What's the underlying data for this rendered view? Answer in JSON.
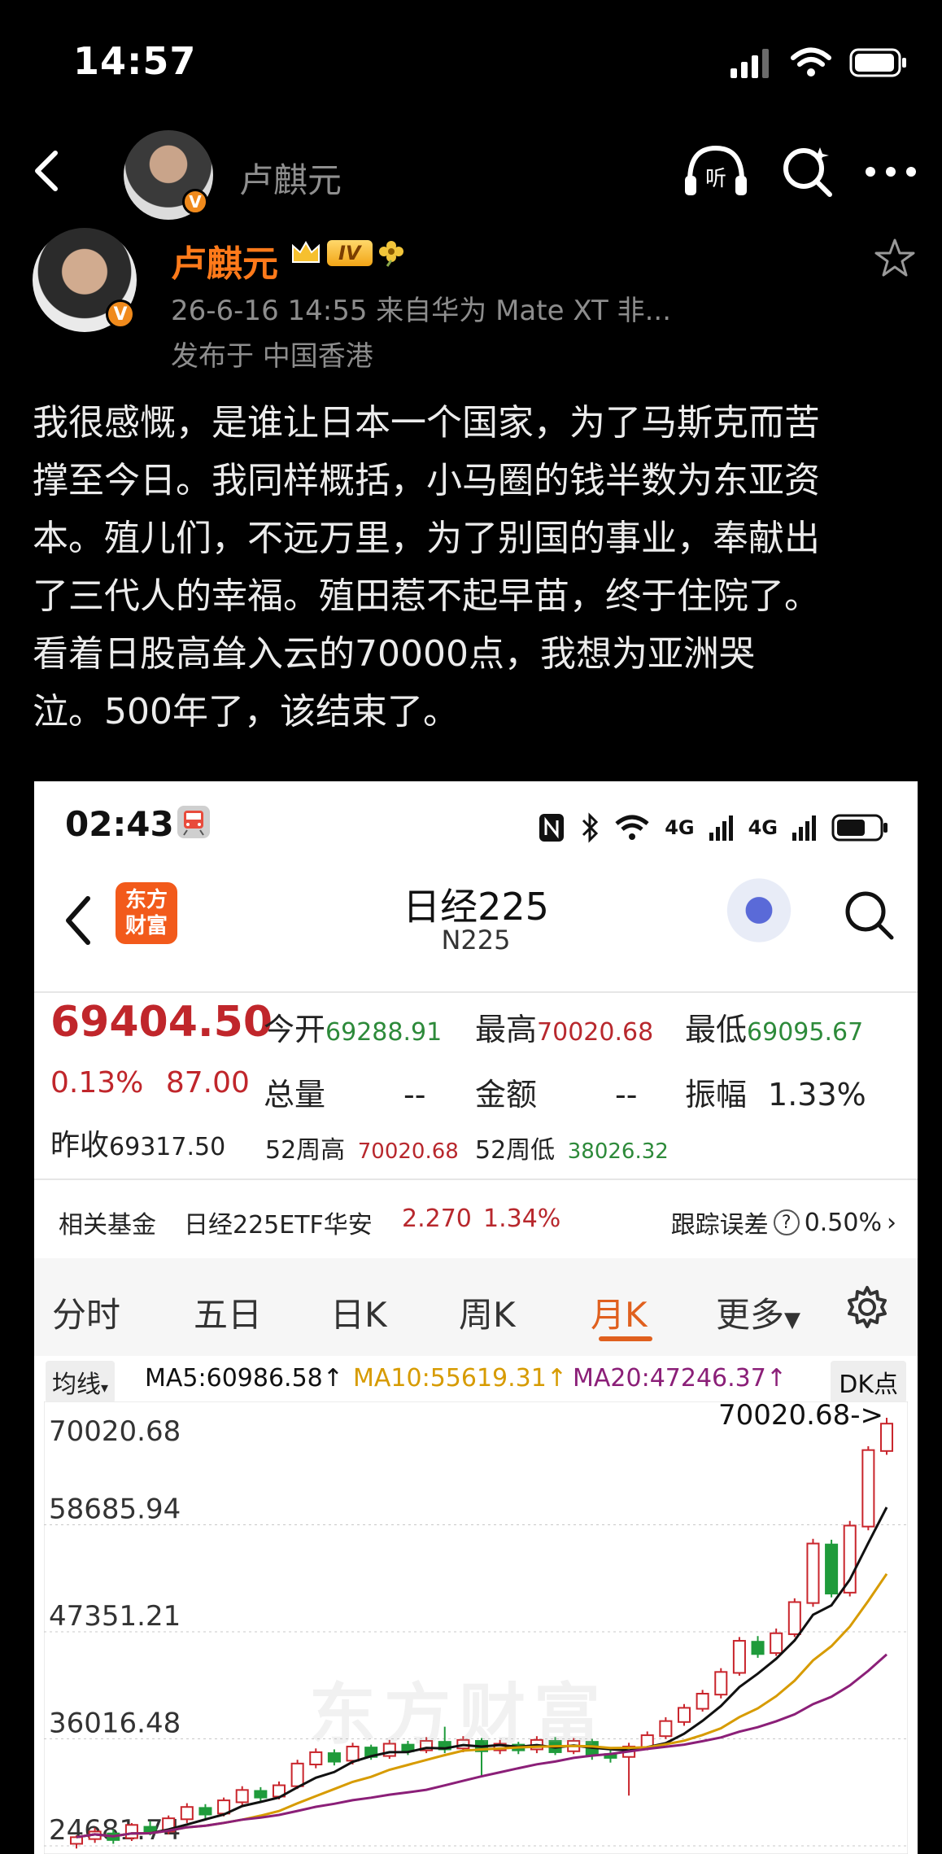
{
  "status_bar": {
    "time": "14:57"
  },
  "nav": {
    "title": "卢麒元"
  },
  "post": {
    "author": "卢麒元",
    "level": "IV",
    "meta_line": "26-6-16 14:55  来自华为 Mate XT 非...",
    "location_line": "发布于 中国香港",
    "content_lines": [
      "我很感慨，是谁让日本一个国家，为了马斯克而苦",
      "撑至今日。我同样概括，小马圈的钱半数为东亚资",
      "本。殖儿们，不远万里，为了别国的事业，奉献出",
      "了三代人的幸福。殖田惹不起早苗，终于住院了。",
      "看着日股高耸入云的70000点，我想为亚洲哭",
      "泣。500年了，该结束了。"
    ]
  },
  "shot": {
    "status_time": "02:43",
    "net_label_1": "4G",
    "net_label_2": "4G",
    "logo_line1": "东方",
    "logo_line2": "财富",
    "title": "日经225",
    "subtitle": "N225",
    "price": "69404.50",
    "change_pct": "0.13%",
    "change_abs": "87.00",
    "prev_close_label": "昨收",
    "prev_close": "69317.50",
    "open_label": "今开",
    "open": "69288.91",
    "high_label": "最高",
    "high": "70020.68",
    "low_label": "最低",
    "low": "69095.67",
    "volume_label": "总量",
    "volume": "--",
    "amount_label": "金额",
    "amount": "--",
    "amplitude_label": "振幅",
    "amplitude": "1.33%",
    "wk52_high_label": "52周高",
    "wk52_high": "70020.68",
    "wk52_low_label": "52周低",
    "wk52_low": "38026.32",
    "fund_label": "相关基金",
    "fund_name": "日经225ETF华安",
    "fund_price": "2.270",
    "fund_pct": "1.34%",
    "tracking_label": "跟踪误差",
    "tracking_value": "0.50%",
    "tabs": [
      "分时",
      "五日",
      "日K",
      "周K",
      "月K",
      "更多"
    ],
    "ma_selector": "均线",
    "ma5": "MA5:60986.58↑",
    "ma10": "MA10:55619.31↑",
    "ma20": "MA20:47246.37↑",
    "dk": "DK点",
    "watermark": "东方财富"
  },
  "chart_data": {
    "type": "candlestick",
    "y_ticks": [
      "70020.68",
      "58685.94",
      "47351.21",
      "36016.48",
      "24681.74"
    ],
    "ylim": [
      24681.74,
      70020.68
    ],
    "max_annotation": "70020.68->",
    "candles": [
      [
        24900,
        25600,
        24400,
        25800
      ],
      [
        25400,
        26200,
        25000,
        26600
      ],
      [
        26000,
        25300,
        24900,
        26400
      ],
      [
        25500,
        26900,
        25200,
        27100
      ],
      [
        26700,
        26100,
        25800,
        27300
      ],
      [
        26200,
        27600,
        25900,
        27900
      ],
      [
        27500,
        28800,
        27100,
        29200
      ],
      [
        28700,
        28000,
        27600,
        29100
      ],
      [
        28100,
        29500,
        27800,
        29800
      ],
      [
        29300,
        30600,
        29000,
        31000
      ],
      [
        30500,
        29800,
        29400,
        30900
      ],
      [
        29900,
        31100,
        29600,
        31500
      ],
      [
        31000,
        33400,
        30700,
        33800
      ],
      [
        33300,
        34600,
        32900,
        35000
      ],
      [
        34500,
        33600,
        33200,
        34900
      ],
      [
        33700,
        35200,
        33300,
        35600
      ],
      [
        35100,
        34100,
        33800,
        35400
      ],
      [
        34200,
        35500,
        33900,
        35900
      ],
      [
        35400,
        34700,
        34300,
        35800
      ],
      [
        34800,
        35800,
        34500,
        36200
      ],
      [
        35700,
        34900,
        34500,
        37300
      ],
      [
        35000,
        35900,
        34600,
        36300
      ],
      [
        35800,
        34700,
        32000,
        36100
      ],
      [
        34800,
        35500,
        34400,
        35900
      ],
      [
        35400,
        34800,
        34400,
        35700
      ],
      [
        34900,
        35900,
        34500,
        36300
      ],
      [
        35800,
        34600,
        34300,
        36200
      ],
      [
        34700,
        35800,
        34400,
        36100
      ],
      [
        35700,
        34300,
        33800,
        36000
      ],
      [
        34400,
        34000,
        33500,
        34800
      ],
      [
        34100,
        35200,
        30000,
        35600
      ],
      [
        35100,
        36400,
        34800,
        36800
      ],
      [
        36300,
        37900,
        36000,
        38300
      ],
      [
        37800,
        39300,
        37400,
        39700
      ],
      [
        39200,
        40800,
        38900,
        41200
      ],
      [
        40700,
        43100,
        40300,
        43500
      ],
      [
        43000,
        46400,
        42700,
        46800
      ],
      [
        46300,
        45000,
        44600,
        46900
      ],
      [
        45100,
        47200,
        44800,
        47700
      ],
      [
        47100,
        50500,
        46800,
        50900
      ],
      [
        50400,
        56700,
        50000,
        57200
      ],
      [
        56600,
        51400,
        51000,
        57100
      ],
      [
        51500,
        58600,
        51100,
        59100
      ],
      [
        58500,
        66600,
        58100,
        67000
      ],
      [
        66500,
        69400,
        66100,
        70020
      ]
    ],
    "ma_lines": [
      "MA5",
      "MA10",
      "MA20"
    ]
  }
}
